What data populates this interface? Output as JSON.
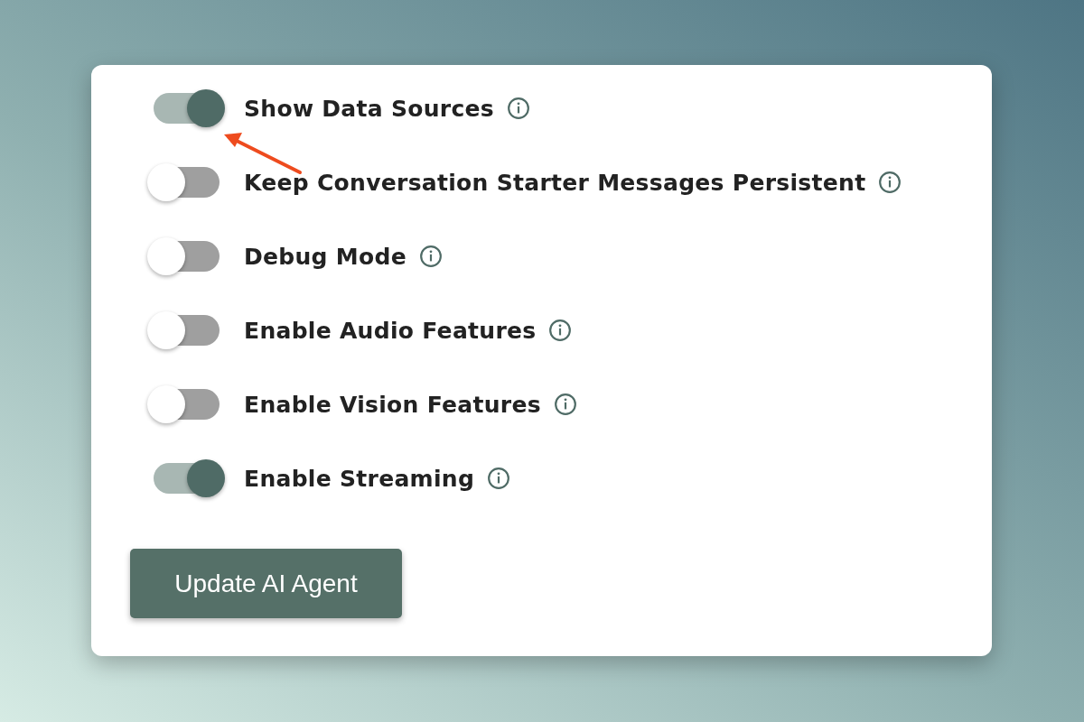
{
  "settings": [
    {
      "label": "Show Data Sources",
      "on": true
    },
    {
      "label": "Keep Conversation Starter Messages Persistent",
      "on": false
    },
    {
      "label": "Debug Mode",
      "on": false
    },
    {
      "label": "Enable Audio Features",
      "on": false
    },
    {
      "label": "Enable Vision Features",
      "on": false
    },
    {
      "label": "Enable Streaming",
      "on": true
    }
  ],
  "button": "Update AI Agent"
}
